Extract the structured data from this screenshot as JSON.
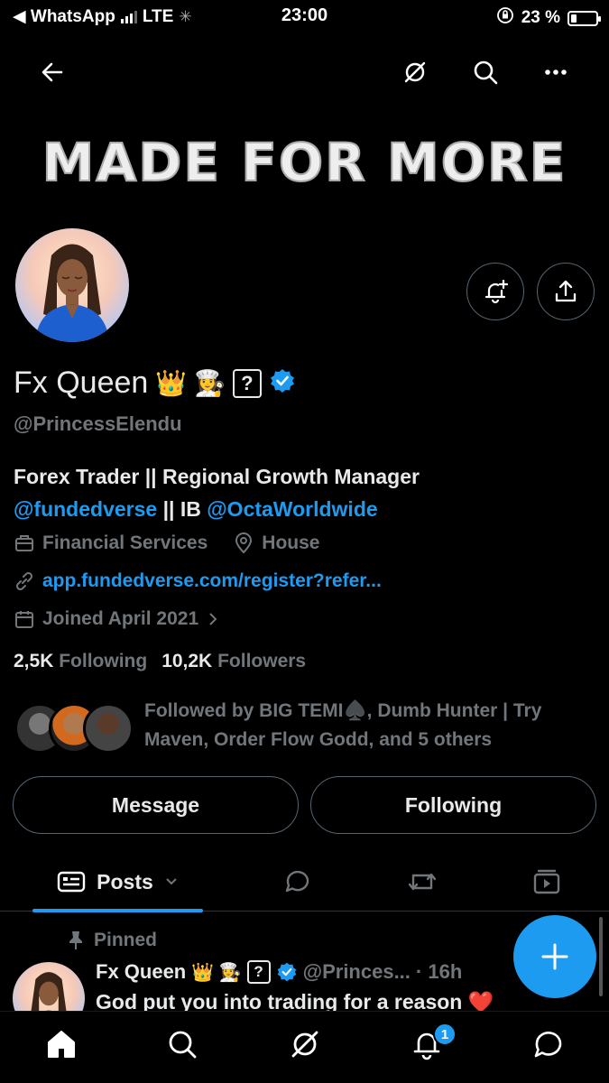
{
  "status_bar": {
    "carrier": "◀ WhatsApp",
    "network": "LTE",
    "time": "23:00",
    "battery_text": "23 %",
    "battery_level": 0.23
  },
  "profile": {
    "banner_text": "MADE FOR MORE",
    "name": "Fx Queen",
    "name_emojis": "👑 👩‍🍳",
    "unknown_glyph": "?",
    "handle": "@PrincessElendu",
    "bio_line1": "Forex Trader || Regional Growth Manager",
    "bio_mention1": "@fundedverse",
    "bio_sep": " || IB ",
    "bio_mention2": "@OctaWorldwide",
    "category": "Financial Services",
    "location": "House",
    "website": "app.fundedverse.com/register?refer...",
    "joined": "Joined April 2021",
    "following_count": "2,5K",
    "following_label": "Following",
    "followers_count": "10,2K",
    "followers_label": "Followers",
    "followed_by": "Followed by BIG TEMI♠️, Dumb Hunter | Try Maven, Order Flow Godd, and 5 others"
  },
  "actions": {
    "message": "Message",
    "following": "Following"
  },
  "tabs": {
    "posts": "Posts"
  },
  "post": {
    "pinned_label": "Pinned",
    "author": "Fx Queen",
    "author_emojis": "👑 👩‍🍳",
    "handle": "@Princes...",
    "time": "· 16h",
    "text": "God put you into trading for a reason ❤️"
  },
  "notifications_badge": "1",
  "colors": {
    "accent": "#1d9bf0",
    "muted": "#71767b",
    "border": "#536471",
    "background": "#000000"
  }
}
